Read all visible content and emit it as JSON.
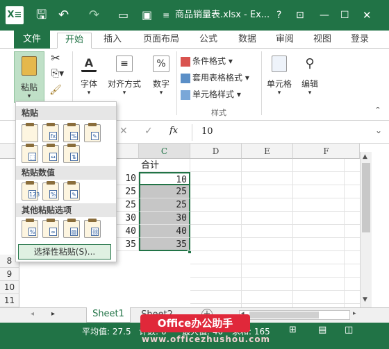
{
  "titlebar": {
    "app_icon": "excel-icon",
    "title": "商品销量表.xlsx - Ex...",
    "help": "?",
    "min": "—",
    "restore": "☐",
    "close": "✕"
  },
  "tabs": [
    "文件",
    "开始",
    "插入",
    "页面布局",
    "公式",
    "数据",
    "审阅",
    "视图",
    "登录"
  ],
  "ribbon": {
    "paste": "粘贴",
    "font": "字体",
    "alignment": "对齐方式",
    "number": "数字",
    "cond_format": "条件格式 ▾",
    "table_format": "套用表格格式 ▾",
    "cell_style": "单元格样式 ▾",
    "styles_group": "样式",
    "cells": "单元格",
    "editing": "编辑"
  },
  "formula": {
    "cancel": "✕",
    "enter": "✓",
    "fx": "fx",
    "value": "10"
  },
  "paste_menu": {
    "section_paste": "粘贴",
    "section_values": "粘贴数值",
    "section_other": "其他粘贴选项",
    "paste_special": "选择性粘贴(S)..."
  },
  "grid": {
    "columns": [
      "C",
      "D",
      "E",
      "F"
    ],
    "rows": [
      "8",
      "9",
      "10",
      "11"
    ],
    "header_cell": "合计",
    "b_values": [
      "10",
      "25",
      "25",
      "30",
      "40",
      "35"
    ],
    "c_values": [
      "10",
      "25",
      "25",
      "30",
      "40",
      "35"
    ]
  },
  "sheets": [
    "Sheet1",
    "Sheet2"
  ],
  "status": {
    "average": "平均值: 27.5",
    "count": "计数: 6",
    "max": "最大值: 40",
    "sum": "求和: 165"
  },
  "watermark": {
    "brand": "Office办公助手",
    "url": "www.officezhushou.com"
  }
}
